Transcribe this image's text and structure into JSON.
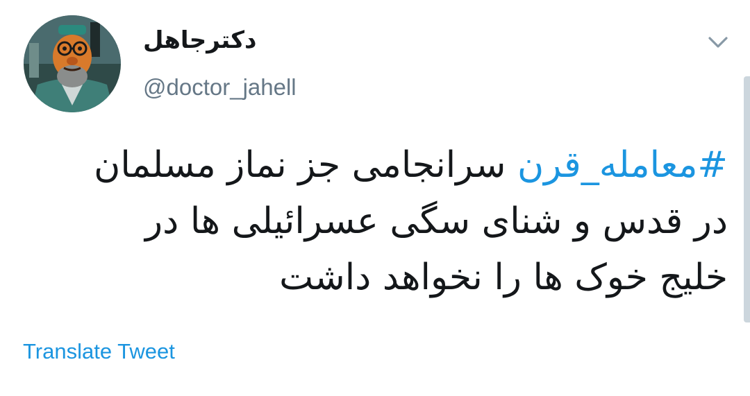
{
  "author": {
    "display_name": "دکترجاهل",
    "handle": "@doctor_jahell",
    "avatar_description": "profile-avatar"
  },
  "menu": {
    "caret_icon": "chevron-down-icon"
  },
  "tweet": {
    "hashtag": "#معامله_قرن",
    "line1_rest": " سرانجامی جز نماز مسلمان",
    "line2": "در قدس و شنای سگی عسرائیلی ها در",
    "line3": "خلیج خوک ها را نخواهد داشت"
  },
  "actions": {
    "translate_label": "Translate Tweet"
  },
  "colors": {
    "link": "#1b95e0",
    "text": "#14171a",
    "secondary": "#657786",
    "scroll": "#ccd6dd"
  }
}
